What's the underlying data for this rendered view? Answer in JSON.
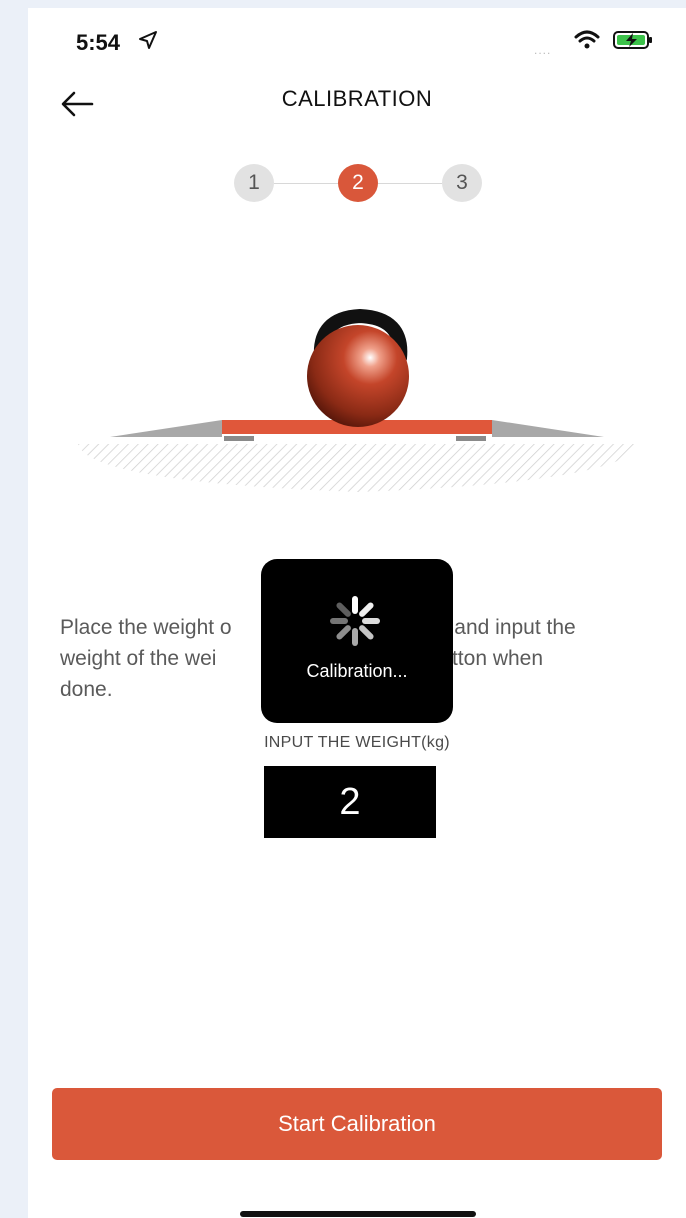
{
  "status_bar": {
    "time": "5:54",
    "signal": "....",
    "icons": [
      "location-arrow-icon",
      "wifi-icon",
      "battery-charging-icon"
    ]
  },
  "nav": {
    "title": "CALIBRATION",
    "back_icon": "arrow-left-icon"
  },
  "stepper": {
    "steps": [
      "1",
      "2",
      "3"
    ],
    "current_step": "2"
  },
  "illustration": {
    "description_icons": [
      "kettlebell-icon",
      "scale-platform-icon"
    ]
  },
  "instructions": {
    "visible_left_part": "Place the weight o",
    "visible_right_part": "les and input the",
    "line2_left": "weight of the wei",
    "line2_right": "xt button when",
    "line3": "done."
  },
  "weight": {
    "label": "INPUT THE WEIGHT(kg)",
    "value": "2"
  },
  "hud": {
    "text": "Calibration..."
  },
  "primary_button": {
    "label": "Start Calibration"
  },
  "colors": {
    "accent": "#d9573a",
    "hud_background": "#000000",
    "page_background": "#ffffff"
  }
}
